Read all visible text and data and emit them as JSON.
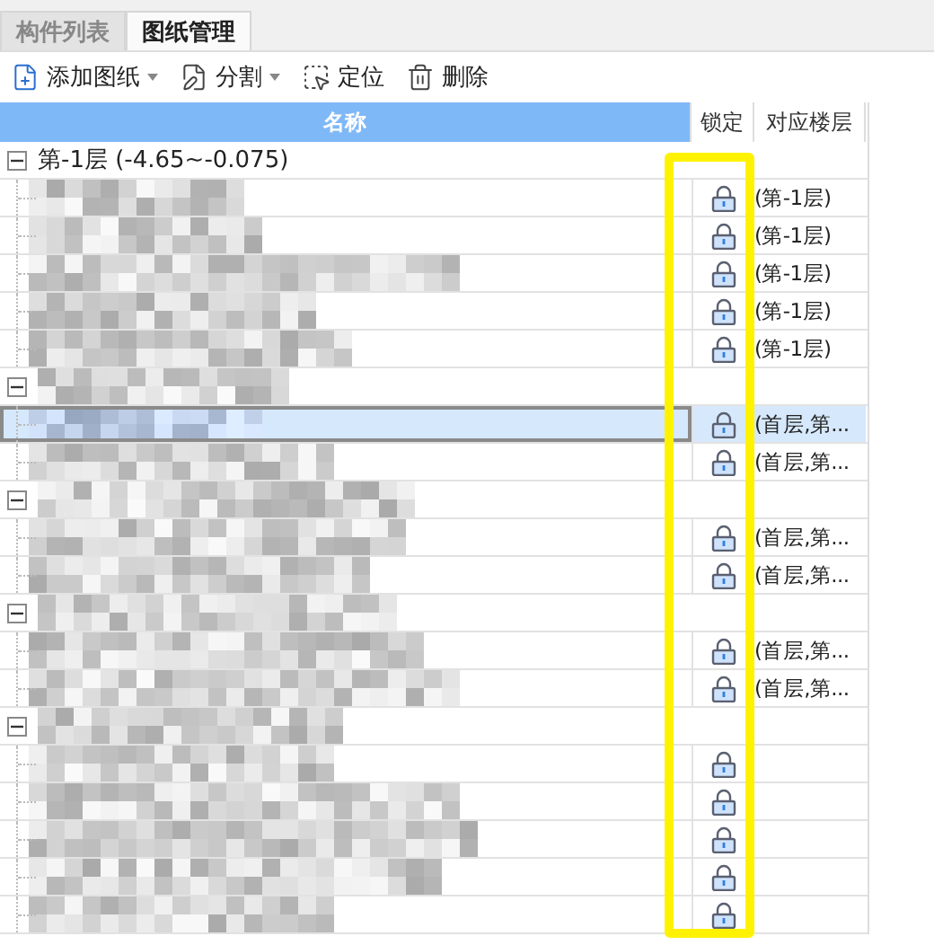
{
  "tabs": [
    {
      "label": "构件列表",
      "selected": false
    },
    {
      "label": "图纸管理",
      "selected": true
    }
  ],
  "toolbar": [
    {
      "kind": "add",
      "label": "添加图纸",
      "dropdown": true
    },
    {
      "kind": "split",
      "label": "分割",
      "dropdown": true
    },
    {
      "kind": "locate",
      "label": "定位",
      "dropdown": false
    },
    {
      "kind": "delete",
      "label": "删除",
      "dropdown": false
    }
  ],
  "table": {
    "columns": [
      {
        "label": "名称",
        "selected": true
      },
      {
        "label": "锁定",
        "selected": false
      },
      {
        "label": "对应楼层",
        "selected": false
      }
    ],
    "groups": [
      {
        "label": "第-1层 (-4.65~-0.075)",
        "redacted": false,
        "expanded": true,
        "children": [
          {
            "redacted": true,
            "locked": true,
            "floor": "(第-1层)",
            "selected": false
          },
          {
            "redacted": true,
            "locked": true,
            "floor": "(第-1层)",
            "selected": false
          },
          {
            "redacted": true,
            "locked": true,
            "floor": "(第-1层)",
            "selected": false
          },
          {
            "redacted": true,
            "locked": true,
            "floor": "(第-1层)",
            "selected": false
          },
          {
            "redacted": true,
            "locked": true,
            "floor": "(第-1层)",
            "selected": false
          }
        ]
      },
      {
        "redacted": true,
        "expanded": true,
        "children": [
          {
            "redacted": true,
            "locked": true,
            "floor": "(首层,第...",
            "selected": true
          },
          {
            "redacted": true,
            "locked": true,
            "floor": "(首层,第...",
            "selected": false
          }
        ]
      },
      {
        "redacted": true,
        "expanded": true,
        "children": [
          {
            "redacted": true,
            "locked": true,
            "floor": "(首层,第...",
            "selected": false
          },
          {
            "redacted": true,
            "locked": true,
            "floor": "(首层,第...",
            "selected": false
          }
        ]
      },
      {
        "redacted": true,
        "expanded": true,
        "children": [
          {
            "redacted": true,
            "locked": true,
            "floor": "(首层,第...",
            "selected": false
          },
          {
            "redacted": true,
            "locked": true,
            "floor": "(首层,第...",
            "selected": false
          }
        ]
      },
      {
        "redacted": true,
        "expanded": true,
        "children": [
          {
            "redacted": true,
            "locked": true,
            "selected": false
          },
          {
            "redacted": true,
            "locked": true,
            "selected": false
          },
          {
            "redacted": true,
            "locked": true,
            "selected": false
          },
          {
            "redacted": true,
            "locked": true,
            "selected": false
          },
          {
            "redacted": true,
            "locked": true,
            "selected": false
          }
        ]
      }
    ]
  },
  "annotation": {
    "kind": "frame"
  }
}
